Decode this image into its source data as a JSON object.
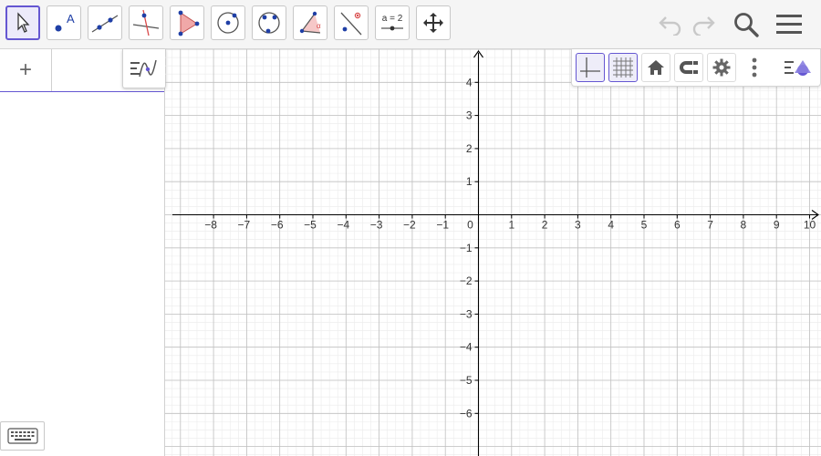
{
  "toolbar": {
    "tools": [
      {
        "name": "move-tool",
        "label": ""
      },
      {
        "name": "point-tool",
        "label": "A"
      },
      {
        "name": "line-tool",
        "label": ""
      },
      {
        "name": "perpendicular-line-tool",
        "label": ""
      },
      {
        "name": "polygon-tool",
        "label": ""
      },
      {
        "name": "circle-center-point-tool",
        "label": ""
      },
      {
        "name": "circle-three-points-tool",
        "label": ""
      },
      {
        "name": "angle-tool",
        "label": ""
      },
      {
        "name": "reflect-tool",
        "label": ""
      },
      {
        "name": "slider-tool",
        "label": "a = 2"
      },
      {
        "name": "move-graphics-view-tool",
        "label": ""
      }
    ],
    "right_icons": [
      "undo-icon",
      "redo-icon",
      "search-icon",
      "menu-icon"
    ]
  },
  "algebra": {
    "add_label": "+",
    "style_button_icon": "algebra-style-icon"
  },
  "style_bar": {
    "buttons": [
      "axes-toggle-icon",
      "grid-toggle-icon",
      "home-icon",
      "point-capturing-icon",
      "gear-icon",
      "more-vert-icon",
      "toggle-style-bar-icon"
    ]
  },
  "graph": {
    "x_ticks": [
      "−8",
      "−7",
      "−6",
      "−5",
      "−4",
      "−3",
      "−2",
      "−1",
      "1",
      "2",
      "3",
      "4",
      "5",
      "6",
      "7",
      "8",
      "9",
      "10"
    ],
    "y_ticks_pos": [
      "1",
      "2",
      "3",
      "4"
    ],
    "y_ticks_neg": [
      "−1",
      "−2",
      "−3",
      "−4",
      "−5",
      "−6"
    ],
    "origin_label": "0",
    "x_range": [
      -9,
      10
    ],
    "y_range": [
      -7,
      5
    ],
    "grid": true,
    "grid_color": "#c0c0c0",
    "axis_color": "#000000"
  },
  "colors": {
    "accent": "#6557d2",
    "point_blue": "#1f3fa6",
    "polygon_fill": "#f0a8a8",
    "red": "#d94a4a"
  },
  "keyboard": {
    "icon": "keyboard-icon"
  }
}
